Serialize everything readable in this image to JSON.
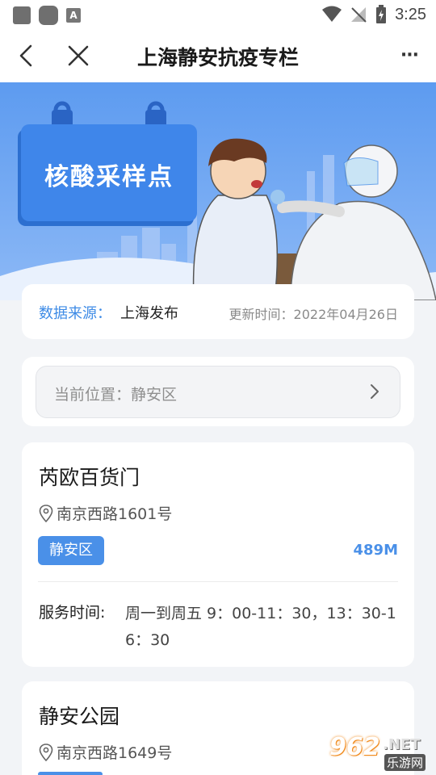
{
  "status_bar": {
    "notif_icon": "A",
    "time": "3:25"
  },
  "nav": {
    "title": "上海静安抗疫专栏",
    "more": "···"
  },
  "banner": {
    "title": "核酸采样点"
  },
  "source": {
    "label": "数据来源：",
    "value": "上海发布",
    "updated": "更新时间：2022年04月26日"
  },
  "location": {
    "text": "当前位置：静安区"
  },
  "sites": [
    {
      "name": "芮欧百货门",
      "address": "南京西路1601号",
      "district": "静安区",
      "distance": "489M",
      "service_label": "服务时间:",
      "service_time": "周一到周五 9：00-11：30，13：30-16：30"
    },
    {
      "name": "静安公园",
      "address": "南京西路1649号"
    }
  ],
  "watermark": {
    "num": "962",
    "net": ".NET",
    "sub": "乐游网"
  },
  "colors": {
    "accent": "#4a90e8",
    "label_blue": "#3e8be6",
    "banner_top": "#5d9bf0"
  }
}
